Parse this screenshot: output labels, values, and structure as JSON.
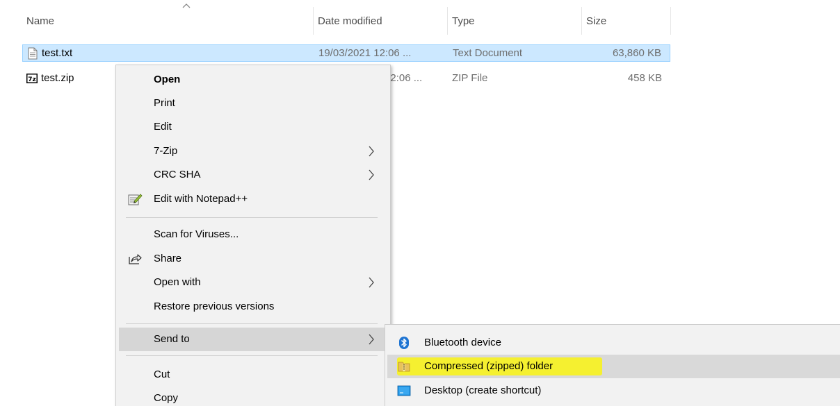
{
  "columns": {
    "name": "Name",
    "date_modified": "Date modified",
    "type": "Type",
    "size": "Size"
  },
  "files": [
    {
      "name": "test.txt",
      "date": "19/03/2021 12:06 ...",
      "type": "Text Document",
      "size": "63,860 KB",
      "icon": "text-file-icon",
      "selected": true
    },
    {
      "name": "test.zip",
      "date": "12:06 ...",
      "type": "ZIP File",
      "size": "458 KB",
      "icon": "7zip-icon",
      "selected": false
    }
  ],
  "context_menu": {
    "items": [
      {
        "label": "Open",
        "bold": true
      },
      {
        "label": "Print"
      },
      {
        "label": "Edit"
      },
      {
        "label": "7-Zip",
        "submenu": true
      },
      {
        "label": "CRC SHA",
        "submenu": true
      },
      {
        "label": "Edit with Notepad++",
        "icon": "notepad-plus-plus-icon"
      },
      {
        "label": "Scan for Viruses..."
      },
      {
        "label": "Share",
        "icon": "share-icon"
      },
      {
        "label": "Open with",
        "submenu": true
      },
      {
        "label": "Restore previous versions"
      },
      {
        "label": "Send to",
        "submenu": true,
        "hover": true
      },
      {
        "label": "Cut"
      },
      {
        "label": "Copy"
      }
    ]
  },
  "send_to_menu": {
    "items": [
      {
        "label": "Bluetooth device",
        "icon": "bluetooth-icon"
      },
      {
        "label": "Compressed (zipped) folder",
        "icon": "zip-folder-icon",
        "hover": true,
        "highlighted": true
      },
      {
        "label": "Desktop (create shortcut)",
        "icon": "desktop-icon"
      }
    ]
  },
  "colors": {
    "selection": "#cce8ff",
    "menu_bg": "#f2f2f2",
    "menu_hover": "#d6d6d6",
    "highlight": "#f5f030",
    "bluetooth": "#1e74d2"
  }
}
